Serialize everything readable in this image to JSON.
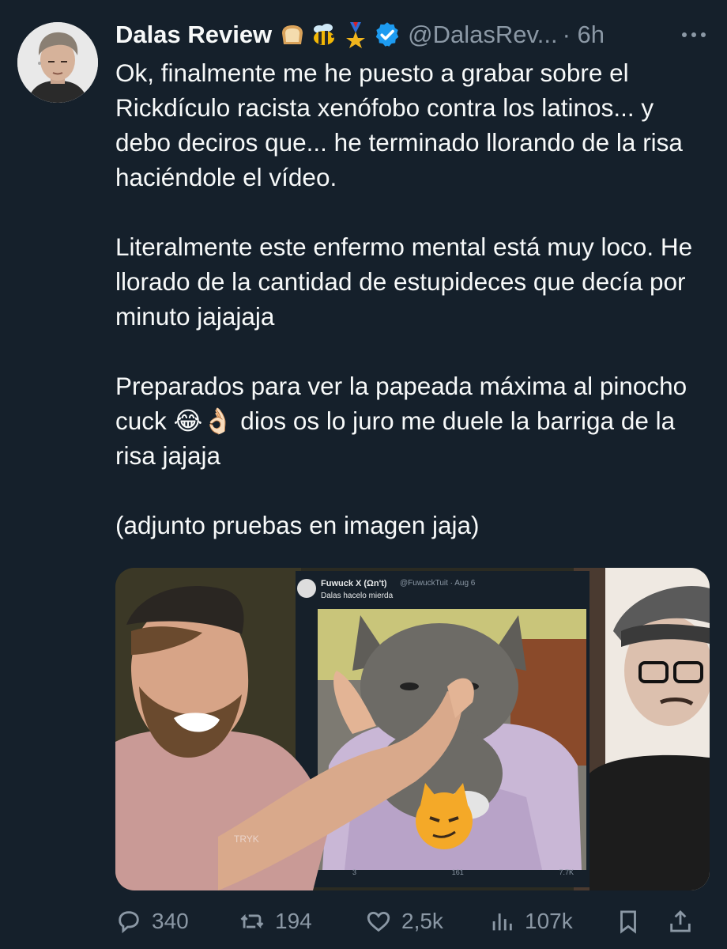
{
  "tweet": {
    "author_name": "Dalas Review",
    "handle": "@DalasRev...",
    "time": "· 6h",
    "badges": [
      "bread-emoji",
      "bee-emoji",
      "medal-emoji",
      "verified-badge"
    ],
    "paragraphs": [
      "Ok, finalmente me he puesto a grabar sobre el Rickdículo racista xenófobo contra los latinos... y debo deciros que... he terminado llorando de la risa haciéndole el vídeo.",
      "Literalmente este enfermo mental está muy loco. He llorado de la cantidad de estupideces que decía por minuto jajajaja",
      "Preparados para ver la papeada máxima al pinocho cuck 😂👌🏻 dios os lo juro me duele la barriga de la risa jajaja",
      "(adjunto pruebas en imagen jaja)"
    ]
  },
  "media": {
    "embedded_tweet": {
      "name": "Fuwuck X (Ωn't)",
      "handle": "@FuwuckTuit · Aug 6",
      "text": "Dalas hacelo mierda",
      "stats": [
        "3",
        "161",
        "7.7K"
      ]
    },
    "shirt_text": "TRYK"
  },
  "actions": {
    "replies": "340",
    "retweets": "194",
    "likes": "2,5k",
    "views": "107k"
  },
  "colors": {
    "background": "#15202b",
    "text": "#f7f9f9",
    "secondary": "#8b98a5",
    "verified": "#1d9bf0"
  }
}
